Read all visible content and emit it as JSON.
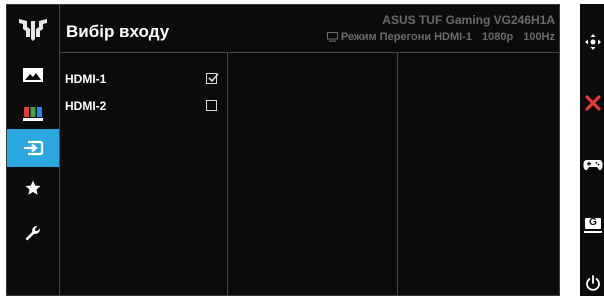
{
  "header": {
    "title": "Вибір входу",
    "model": "ASUS TUF Gaming VG246H1A",
    "status": {
      "mode": "Режим Перегони",
      "input": "HDMI-1",
      "resolution": "1080p",
      "refresh": "100Hz"
    }
  },
  "sidebar": {
    "logo": "tuf-logo",
    "items": [
      {
        "icon": "image-icon",
        "active": false
      },
      {
        "icon": "color-bars-icon",
        "active": false
      },
      {
        "icon": "input-select-icon",
        "active": true
      },
      {
        "icon": "star-icon",
        "active": false
      },
      {
        "icon": "wrench-icon",
        "active": false
      }
    ],
    "active_color": "#2aa7dc"
  },
  "inputs": [
    {
      "label": "HDMI-1",
      "checked": true
    },
    {
      "label": "HDMI-2",
      "checked": false
    }
  ],
  "keypad": [
    {
      "icon": "joystick-icon",
      "color": "#ffffff"
    },
    {
      "icon": "close-icon",
      "color": "#e53935"
    },
    {
      "icon": "gamepad-icon",
      "color": "#ffffff"
    },
    {
      "icon": "gameplus-icon",
      "label": "G",
      "color": "#ffffff"
    },
    {
      "icon": "power-icon",
      "color": "#ffffff"
    }
  ]
}
